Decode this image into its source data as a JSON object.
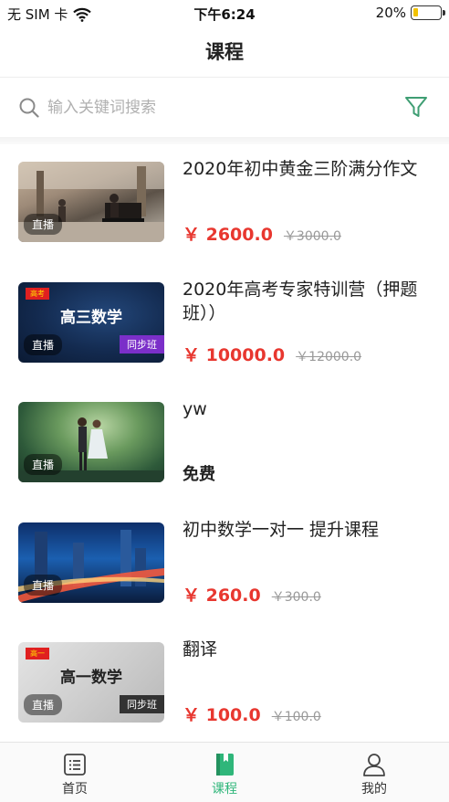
{
  "status_bar": {
    "carrier": "无 SIM 卡",
    "time": "下午6:24",
    "battery": "20%",
    "battery_level": 0.2
  },
  "nav": {
    "title": "课程"
  },
  "search": {
    "placeholder": "输入关键词搜索",
    "value": ""
  },
  "courses": [
    {
      "title": "2020年初中黄金三阶满分作文",
      "price": "￥ 2600.0",
      "original_price": "￥3000.0",
      "live_tag": "直播",
      "thumb_icon": "piano-player-image"
    },
    {
      "title": "2020年高考专家特训营（押题班））",
      "price": "￥ 10000.0",
      "original_price": "￥12000.0",
      "live_tag": "直播",
      "thumb_text": "高三数学",
      "thumb_ribbon": "高考",
      "thumb_sync": "同步班",
      "thumb_icon": "math-poster-image"
    },
    {
      "title": "yw",
      "free_label": "免费",
      "live_tag": "直播",
      "thumb_icon": "couple-garden-image"
    },
    {
      "title": "初中数学一对一 提升课程",
      "price": "￥ 260.0",
      "original_price": "￥300.0",
      "live_tag": "直播",
      "thumb_icon": "city-night-image"
    },
    {
      "title": "翻译",
      "price": "￥ 100.0",
      "original_price": "￥100.0",
      "live_tag": "直播",
      "thumb_text": "高一数学",
      "thumb_ribbon": "高一",
      "thumb_sync": "同步班",
      "thumb_icon": "math-poster-grey-image"
    }
  ],
  "tab_bar": {
    "items": [
      {
        "label": "首页",
        "icon": "home-list-icon",
        "active": false
      },
      {
        "label": "课程",
        "icon": "book-icon",
        "active": true
      },
      {
        "label": "我的",
        "icon": "profile-icon",
        "active": false
      }
    ]
  },
  "colors": {
    "accent": "#2fb67a",
    "price": "#e8372f",
    "muted": "#999999"
  }
}
